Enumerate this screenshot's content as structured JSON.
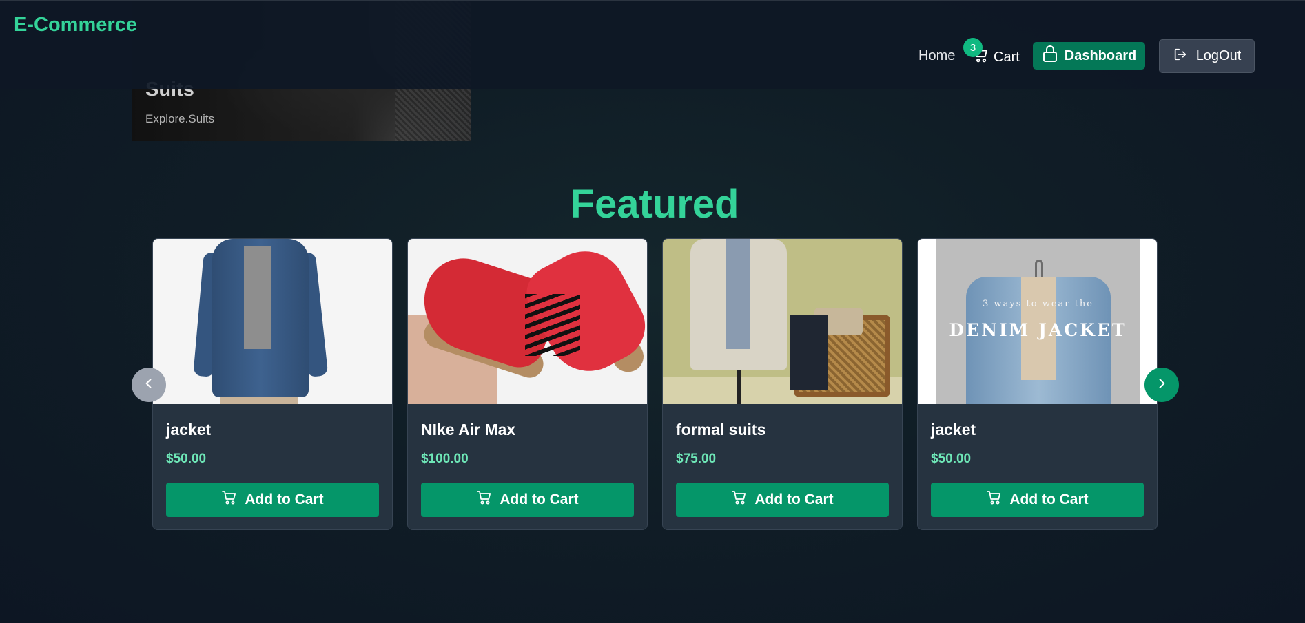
{
  "header": {
    "brand": "E-Commerce",
    "nav": {
      "home_label": "Home",
      "cart_label": "Cart",
      "cart_count": "3"
    },
    "dashboard_label": "Dashboard",
    "logout_label": "LogOut"
  },
  "category_banner": {
    "title": "Suits",
    "link_label": "Explore.Suits"
  },
  "featured": {
    "title": "Featured",
    "products": [
      {
        "name": "jacket",
        "price": "$50.00",
        "button_label": "Add to Cart"
      },
      {
        "name": "NIke Air Max",
        "price": "$100.00",
        "button_label": "Add to Cart"
      },
      {
        "name": "formal suits",
        "price": "$75.00",
        "button_label": "Add to Cart"
      },
      {
        "name": "jacket",
        "price": "$50.00",
        "button_label": "Add to Cart",
        "image_caption_small": "3 ways to wear the",
        "image_caption_large": "DENIM JACKET"
      }
    ]
  },
  "icons": {
    "cart": "cart-icon",
    "dashboard": "lock-icon",
    "logout": "logout-icon",
    "prev": "chevron-left-icon",
    "next": "chevron-right-icon"
  },
  "colors": {
    "accent": "#34d399",
    "button_primary": "#059669",
    "dashboard_button": "#047857",
    "price": "#6ee7b7",
    "card_bg": "#263340",
    "page_bg": "#101d26"
  }
}
